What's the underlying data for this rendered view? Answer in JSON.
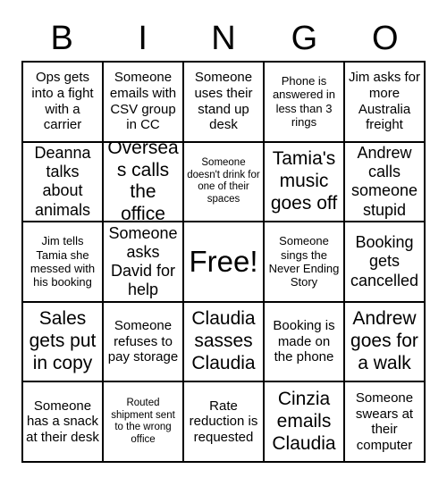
{
  "header": {
    "letters": [
      "B",
      "I",
      "N",
      "G",
      "O"
    ]
  },
  "grid": {
    "rows": 5,
    "columns": 5,
    "border_color": "#000000",
    "background_color": "#ffffff",
    "text_color": "#000000",
    "cells": [
      {
        "text": "Ops gets into a fight with a carrier",
        "size": "md",
        "free": false
      },
      {
        "text": "Someone emails with CSV group in CC",
        "size": "md",
        "free": false
      },
      {
        "text": "Someone uses their stand up desk",
        "size": "md",
        "free": false
      },
      {
        "text": "Phone is answered in less than 3 rings",
        "size": "sm",
        "free": false
      },
      {
        "text": "Jim asks for more Australia freight",
        "size": "md",
        "free": false
      },
      {
        "text": "Deanna talks about animals",
        "size": "lg",
        "free": false
      },
      {
        "text": "Overseas calls the office",
        "size": "xl",
        "free": false
      },
      {
        "text": "Someone doesn't drink for one of their spaces",
        "size": "xs",
        "free": false
      },
      {
        "text": "Tamia's music goes off",
        "size": "xl",
        "free": false
      },
      {
        "text": "Andrew calls someone stupid",
        "size": "lg",
        "free": false
      },
      {
        "text": "Jim tells Tamia she messed with his booking",
        "size": "sm",
        "free": false
      },
      {
        "text": "Someone asks David for help",
        "size": "lg",
        "free": false
      },
      {
        "text": "Free!",
        "size": "free",
        "free": true
      },
      {
        "text": "Someone sings the Never Ending Story",
        "size": "sm",
        "free": false
      },
      {
        "text": "Booking gets cancelled",
        "size": "lg",
        "free": false
      },
      {
        "text": "Sales gets put in copy",
        "size": "xl",
        "free": false
      },
      {
        "text": "Someone refuses to pay storage",
        "size": "md",
        "free": false
      },
      {
        "text": "Claudia sasses Claudia",
        "size": "xl",
        "free": false
      },
      {
        "text": "Booking is made on the phone",
        "size": "md",
        "free": false
      },
      {
        "text": "Andrew goes for a walk",
        "size": "xl",
        "free": false
      },
      {
        "text": "Someone has a snack at their desk",
        "size": "md",
        "free": false
      },
      {
        "text": "Routed shipment sent to the wrong office",
        "size": "xs",
        "free": false
      },
      {
        "text": "Rate reduction is requested",
        "size": "md",
        "free": false
      },
      {
        "text": "Cinzia emails Claudia",
        "size": "xl",
        "free": false
      },
      {
        "text": "Someone swears at their computer",
        "size": "md",
        "free": false
      }
    ]
  }
}
